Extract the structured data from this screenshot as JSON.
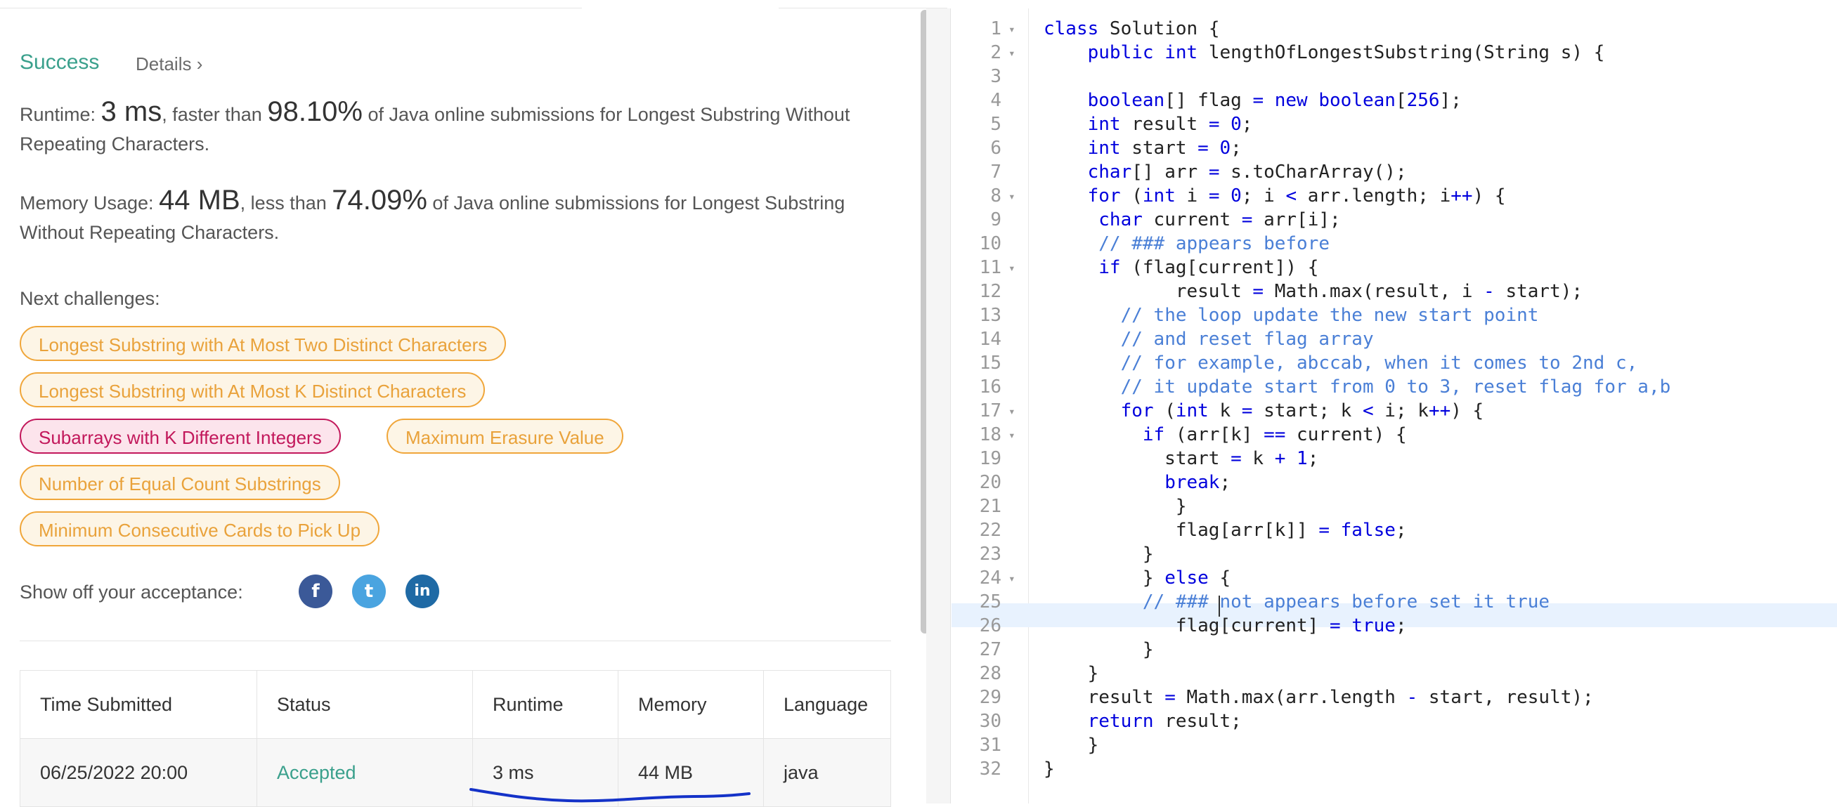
{
  "result": {
    "status": "Success",
    "details_label": "Details ›",
    "runtime_prefix": "Runtime: ",
    "runtime_value": "3 ms",
    "runtime_mid": ", faster than ",
    "runtime_pct": "98.10%",
    "runtime_suffix": " of Java online submissions for Longest Substring Without Repeating Characters.",
    "memory_prefix": "Memory Usage: ",
    "memory_value": "44 MB",
    "memory_mid": ", less than ",
    "memory_pct": "74.09%",
    "memory_suffix": " of Java online submissions for Longest Substring Without Repeating Characters.",
    "next_label": "Next challenges:",
    "challenges": [
      {
        "label": "Longest Substring with At Most Two Distinct Characters",
        "difficulty": "medium"
      },
      {
        "label": "Longest Substring with At Most K Distinct Characters",
        "difficulty": "medium"
      },
      {
        "label": "Subarrays with K Different Integers",
        "difficulty": "hard"
      },
      {
        "label": "Maximum Erasure Value",
        "difficulty": "medium"
      },
      {
        "label": "Number of Equal Count Substrings",
        "difficulty": "medium"
      },
      {
        "label": "Minimum Consecutive Cards to Pick Up",
        "difficulty": "medium"
      }
    ],
    "share_label": "Show off your acceptance:",
    "social": [
      {
        "icon": "facebook-icon",
        "glyph": "f",
        "color": "#3b5998"
      },
      {
        "icon": "twitter-icon",
        "glyph": "t",
        "color": "#4aa4e0"
      },
      {
        "icon": "linkedin-icon",
        "glyph": "in",
        "color": "#1f6aa5"
      }
    ]
  },
  "submissions": {
    "headers": [
      "Time Submitted",
      "Status",
      "Runtime",
      "Memory",
      "Language"
    ],
    "rows": [
      [
        "06/25/2022 20:00",
        "Accepted",
        "3 ms",
        "44 MB",
        "java"
      ]
    ]
  },
  "editor": {
    "lines": [
      "class Solution {",
      "    public int lengthOfLongestSubstring(String s) {",
      "",
      "    boolean[] flag = new boolean[256];",
      "    int result = 0;",
      "    int start = 0;",
      "    char[] arr = s.toCharArray();",
      "    for (int i = 0; i < arr.length; i++) {",
      "     char current = arr[i];",
      "     // ### appears before",
      "     if (flag[current]) {",
      "            result = Math.max(result, i - start);",
      "       // the loop update the new start point",
      "       // and reset flag array",
      "       // for example, abccab, when it comes to 2nd c,",
      "       // it update start from 0 to 3, reset flag for a,b",
      "       for (int k = start; k < i; k++) {",
      "         if (arr[k] == current) {",
      "           start = k + 1;",
      "           break;",
      "            }",
      "            flag[arr[k]] = false;",
      "         }",
      "         } else {",
      "         // ### not appears before set it true",
      "            flag[current] = true;",
      "         }",
      "    }",
      "    result = Math.max(arr.length - start, result);",
      "    return result;",
      "    }",
      "}"
    ],
    "foldable_lines": [
      1,
      2,
      8,
      11,
      17,
      18,
      24
    ],
    "active_line": 25
  }
}
